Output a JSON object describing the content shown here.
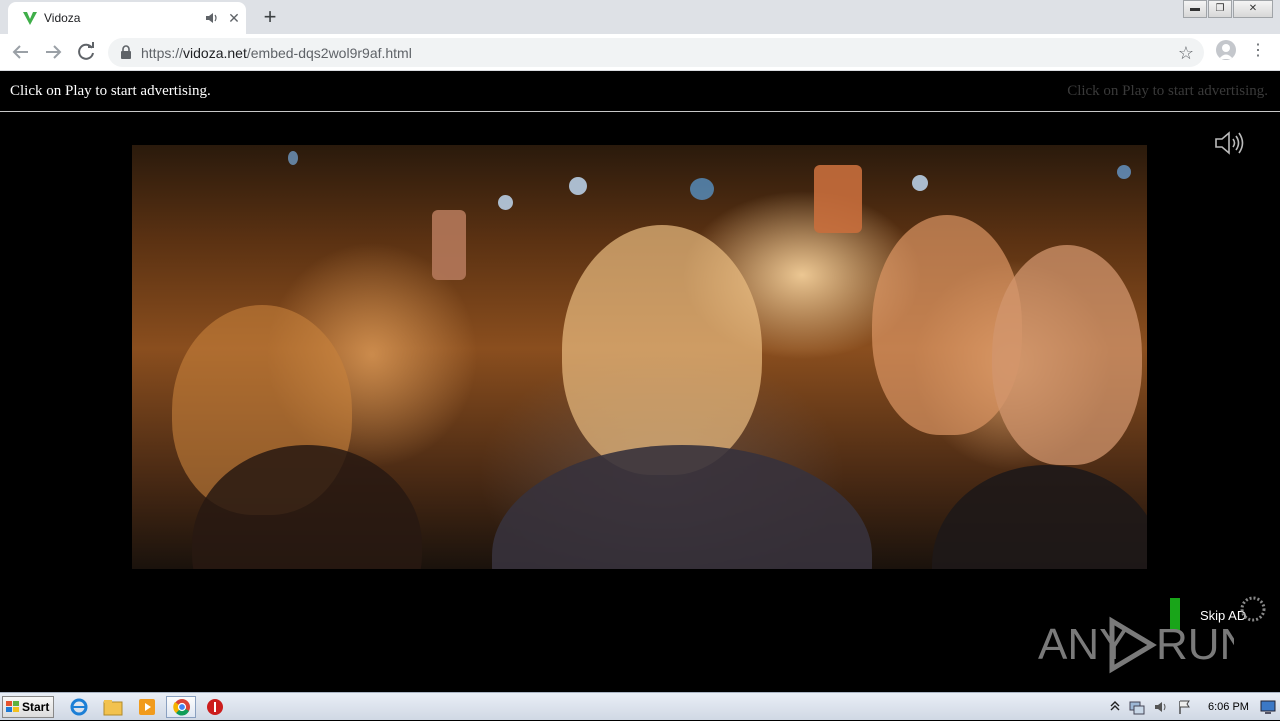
{
  "browser": {
    "tab": {
      "title": "Vidoza",
      "favicon": "vidoza-v-logo",
      "audio": "speaker-icon",
      "close": "✕"
    },
    "new_tab": "+",
    "window_controls": [
      "minimize",
      "restore",
      "close"
    ],
    "address": {
      "scheme": "https://",
      "host": "vidoza.net",
      "path": "/embed-dqs2wol9r9af.html"
    },
    "star": "☆",
    "menu": "⋮"
  },
  "page": {
    "ad_left": "Click on Play to start advertising.",
    "ad_right": "Click on Play to start advertising.",
    "skip_ad": "Skip AD",
    "watermark_a": "ANY",
    "watermark_b": "RUN"
  },
  "taskbar": {
    "start": "Start",
    "apps": [
      "internet-explorer-icon",
      "file-explorer-icon",
      "media-player-icon",
      "chrome-icon",
      "stop-icon"
    ],
    "clock": "6:06 PM"
  },
  "colors": {
    "tab_strip": "#dee1e6",
    "skip_bar": "#19a519",
    "page_bg": "#000000"
  }
}
